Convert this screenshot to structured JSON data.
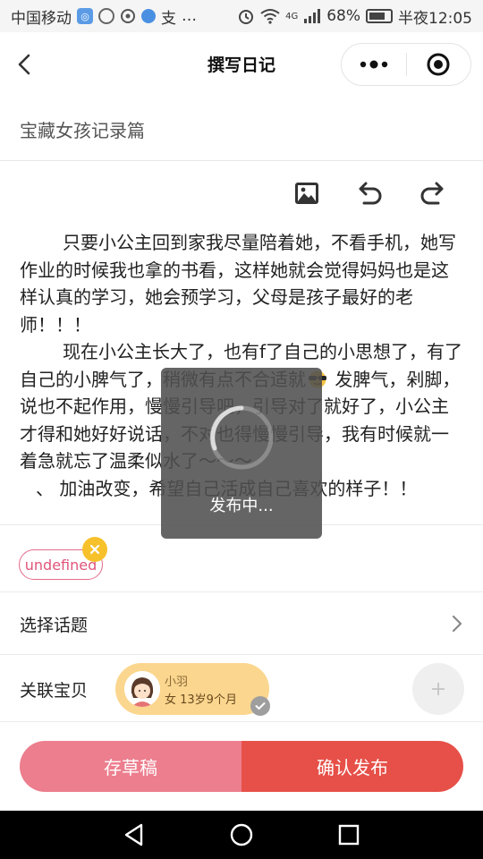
{
  "status": {
    "carrier": "中国移动",
    "network": "4G",
    "battery": "68%",
    "time": "半夜12:05",
    "more": "…",
    "extra": "支"
  },
  "nav": {
    "title": "撰写日记",
    "more_icon": "more-dots-icon",
    "close_icon": "target-icon"
  },
  "form": {
    "title_value": "宝藏女孩记录篇"
  },
  "content": {
    "para1": "只要小公主回到家我尽量陪着她，不看手机，她写作业的时候我也拿的书看，这样她就会觉得妈妈也是这样认真的学习，她会预学习，父母是孩子最好的老师！！！",
    "para2a": "现在小公主长大了，也有f了自己的小思想了，有了自己的小脾气了，稍微有点不合适就",
    "para2b": " 发脾气，剁脚，说也不起作用，慢慢引导吧，引导对了就好了，小公主才得和她好好说话，不对也得慢慢引导，我有时候就一着急就忘了温柔似水了～～～",
    "para3": "、 加油改变，希望自己活成自己喜欢的样子！！"
  },
  "tag": {
    "label": "undefined"
  },
  "topic": {
    "label": "选择话题"
  },
  "baby": {
    "label": "关联宝贝",
    "name": "小羽",
    "info": "女  13岁9个月"
  },
  "actions": {
    "draft": "存草稿",
    "publish": "确认发布"
  },
  "loading": {
    "text": "发布中..."
  },
  "colors": {
    "draft": "#ec7e8e",
    "publish": "#e65048",
    "tag": "#e0557a",
    "baby_card": "#fbd68e"
  }
}
